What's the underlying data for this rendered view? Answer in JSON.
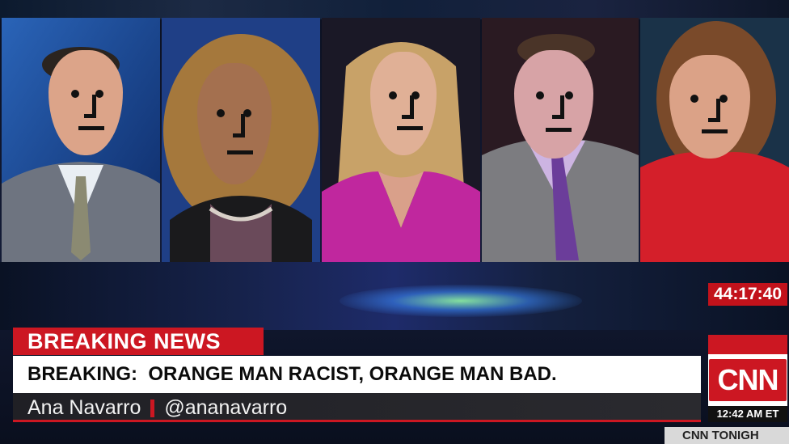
{
  "clock": "44:17:40",
  "breaking_label": "BREAKING NEWS",
  "headline": "BREAKING:  ORANGE MAN RACIST, ORANGE MAN BAD.",
  "guest_name": "Ana Navarro",
  "guest_handle": "@ananavarro",
  "network_logo": "CNN",
  "time": "12:42 AM ET",
  "show_name": "CNN TONIGH",
  "colors": {
    "brand_red": "#cc1722",
    "headline_bg": "#ffffff",
    "name_bar": "#202025"
  }
}
